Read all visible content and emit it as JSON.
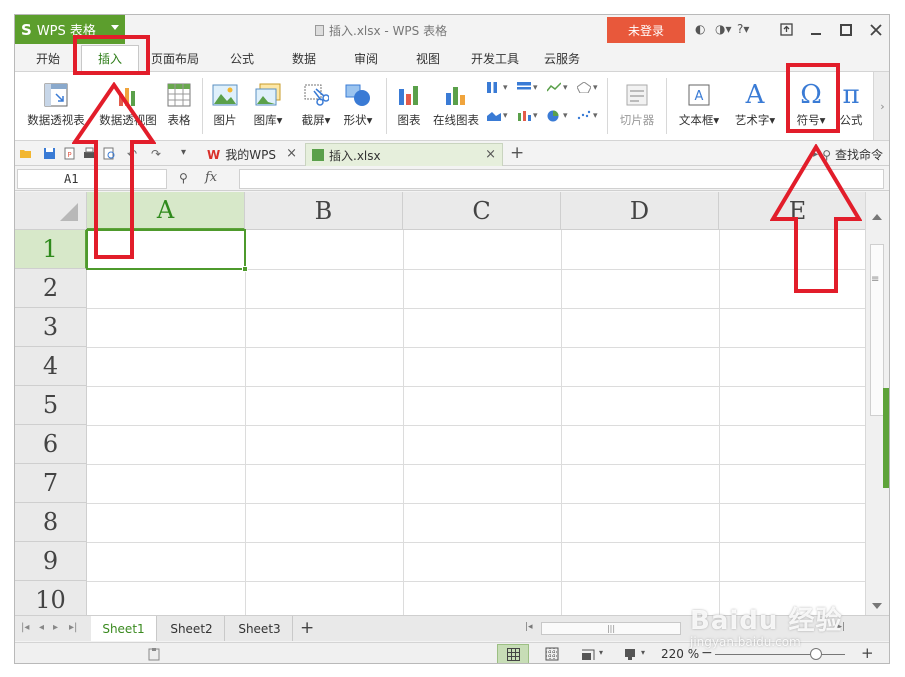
{
  "window": {
    "app_name": "WPS 表格",
    "doc_title": "插入.xlsx - WPS 表格",
    "login_label": "未登录",
    "help_label": "?"
  },
  "menu_tabs": [
    {
      "label": "开始"
    },
    {
      "label": "插入",
      "active": true
    },
    {
      "label": "页面布局"
    },
    {
      "label": "公式"
    },
    {
      "label": "数据"
    },
    {
      "label": "审阅"
    },
    {
      "label": "视图"
    },
    {
      "label": "开发工具"
    },
    {
      "label": "云服务"
    }
  ],
  "ribbon": {
    "pivot_table": "数据透视表",
    "pivot_chart": "数据透视图",
    "table": "表格",
    "picture": "图片",
    "gallery": "图库",
    "screenshot": "截屏",
    "shape": "形状",
    "chart": "图表",
    "online_chart": "在线图表",
    "slicer": "切片器",
    "textbox": "文本框",
    "wordart": "艺术字",
    "symbol": "符号",
    "equation": "公式",
    "symbol_glyph": "Ω",
    "equation_glyph": "π",
    "wordart_glyph": "A"
  },
  "doc_tabs": {
    "tab1": "我的WPS",
    "tab2": "插入.xlsx",
    "find_command": "查找命令"
  },
  "formula_bar": {
    "cell_ref": "A1",
    "fx_label": "fx",
    "value": ""
  },
  "grid": {
    "columns": [
      "A",
      "B",
      "C",
      "D",
      "E"
    ],
    "rows": [
      "1",
      "2",
      "3",
      "4",
      "5",
      "6",
      "7",
      "8",
      "9",
      "10"
    ]
  },
  "sheets": [
    {
      "label": "Sheet1",
      "active": true
    },
    {
      "label": "Sheet2"
    },
    {
      "label": "Sheet3"
    }
  ],
  "status": {
    "zoom": "220 %"
  },
  "watermark": {
    "main": "Baidu 经验",
    "sub": "jingyan.baidu.com"
  },
  "colors": {
    "accent_green": "#5c9e2d",
    "login_red": "#e8583b",
    "annotation_red": "#e21d2a"
  }
}
